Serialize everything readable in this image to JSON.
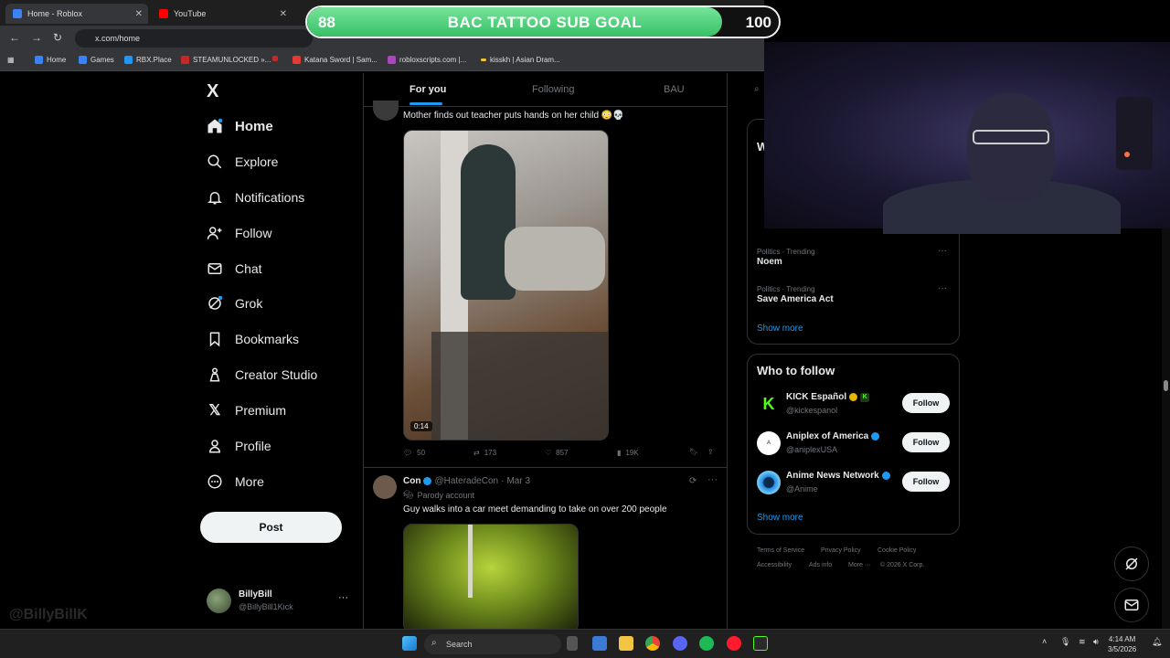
{
  "browser": {
    "tabs": [
      {
        "title": "Home - Roblox",
        "favicon_color": "#3b82f6"
      },
      {
        "title": "YouTube",
        "favicon_color": "#ff0000"
      }
    ],
    "url": "x.com/home",
    "bookmarks": [
      {
        "label": "Home",
        "color": "#3b82f6"
      },
      {
        "label": "Games",
        "color": "#3b82f6"
      },
      {
        "label": "RBX.Place",
        "color": "#2196f3"
      },
      {
        "label": "STEAMUNLOCKED »...",
        "color": "#c62828"
      },
      {
        "label": "",
        "color": "#c62828"
      },
      {
        "label": "Katana Sword | Sam...",
        "color": "#e53935"
      },
      {
        "label": "robloxscripts.com |...",
        "color": "#ab47bc"
      },
      {
        "label": "kisskh | Asian Dram...",
        "color": "#fbc02d"
      }
    ]
  },
  "overlay": {
    "goal_current": "88",
    "goal_title": "BAC TATTOO SUB GOAL",
    "goal_target": "100",
    "goal_progress": 0.88,
    "watermark": "@BillyBillK"
  },
  "nav": {
    "logo": "X",
    "items": [
      {
        "label": "Home",
        "icon": "home-icon"
      },
      {
        "label": "Explore",
        "icon": "search-icon"
      },
      {
        "label": "Notifications",
        "icon": "bell-icon"
      },
      {
        "label": "Follow",
        "icon": "person-add-icon"
      },
      {
        "label": "Chat",
        "icon": "mail-icon"
      },
      {
        "label": "Grok",
        "icon": "grok-icon"
      },
      {
        "label": "Bookmarks",
        "icon": "bookmark-icon"
      },
      {
        "label": "Creator Studio",
        "icon": "creator-studio-icon"
      },
      {
        "label": "Premium",
        "icon": "x-icon"
      },
      {
        "label": "Profile",
        "icon": "person-icon"
      },
      {
        "label": "More",
        "icon": "more-circle-icon"
      }
    ],
    "post_label": "Post",
    "account": {
      "name": "BillyBill",
      "handle": "@BillyBill1Kick"
    }
  },
  "feed": {
    "tabs": [
      "For you",
      "Following",
      "BAU"
    ],
    "posts": [
      {
        "text": "Mother finds out teacher puts hands on her child 😳💀",
        "video_duration": "0:14",
        "replies": "50",
        "reposts": "173",
        "likes": "857",
        "views": "19K"
      },
      {
        "author": "Con",
        "handle": "@HateradeCon",
        "date": "Mar 3",
        "label": "Parody account",
        "text": "Guy walks into a car meet demanding to take on over 200 people"
      }
    ]
  },
  "sidebar": {
    "trends": [
      {
        "category": "Politics · Trending",
        "name": "Noem"
      },
      {
        "category": "Politics · Trending",
        "name": "Save America Act"
      }
    ],
    "show_more": "Show more",
    "who_to_follow_title": "Who to follow",
    "follow_label": "Follow",
    "suggestions": [
      {
        "name": "KICK Español",
        "handle": "@kickespanol",
        "avatar_color": "#53fc18",
        "avatar_text": "K"
      },
      {
        "name": "Aniplex of America",
        "handle": "@aniplexUSA",
        "avatar_color": "#ffffff",
        "avatar_text": "A"
      },
      {
        "name": "Anime News Network",
        "handle": "@Anime",
        "avatar_color": "#1e88e5",
        "avatar_text": ""
      }
    ],
    "footer": [
      "Terms of Service",
      "Privacy Policy",
      "Cookie Policy",
      "Accessibility",
      "Ads info",
      "More ···",
      "© 2026 X Corp."
    ]
  },
  "taskbar": {
    "search_placeholder": "Search",
    "time": "4:14 AM",
    "date": "3/5/2026"
  },
  "colors": {
    "accent": "#1d9bf0",
    "background": "#000000"
  }
}
